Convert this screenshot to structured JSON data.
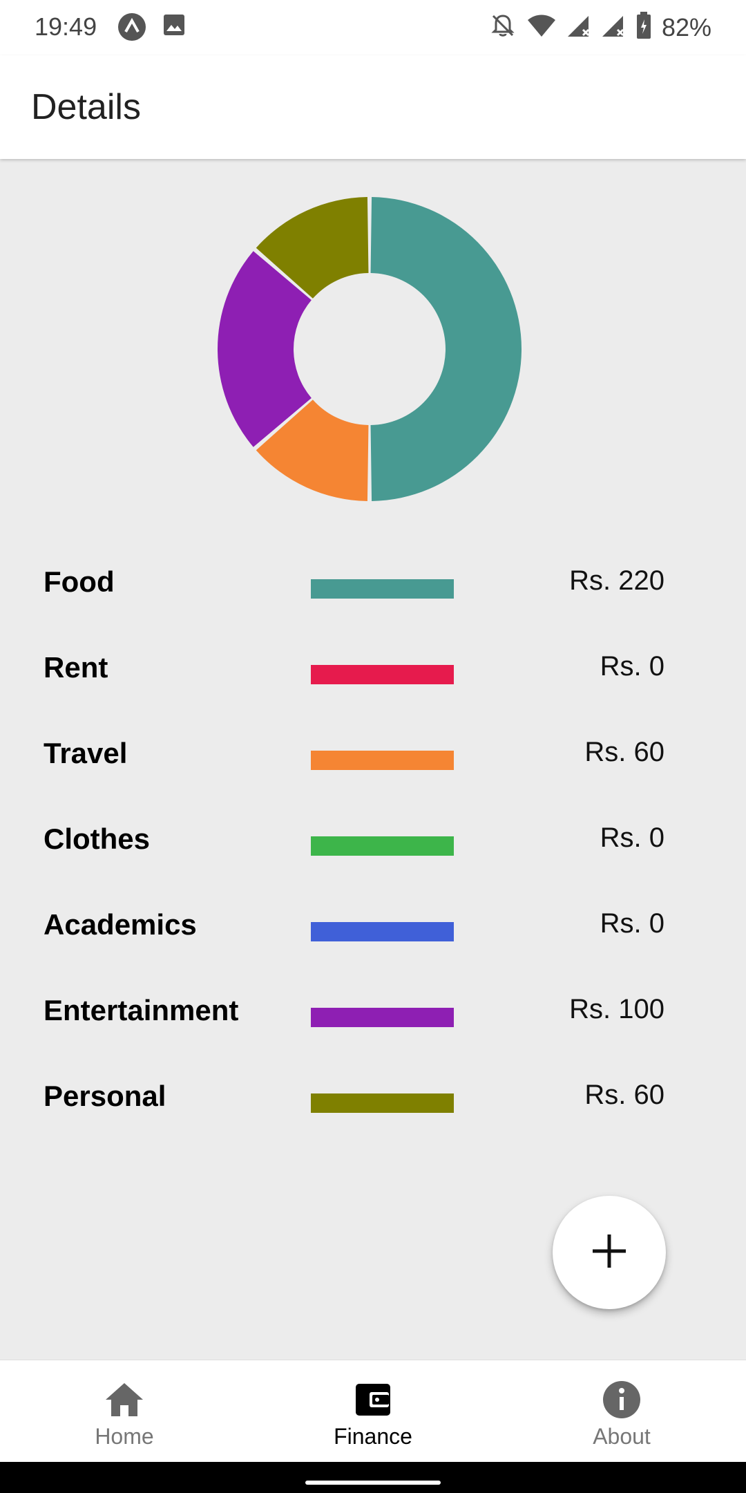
{
  "status_bar": {
    "time": "19:49",
    "battery": "82%",
    "icons": [
      "app-a-icon",
      "image-icon",
      "bell-off-icon",
      "wifi-icon",
      "signal-icon",
      "signal-icon",
      "battery-icon"
    ]
  },
  "app_bar": {
    "title": "Details"
  },
  "colors": {
    "food": "#489a92",
    "rent": "#e61b4d",
    "travel": "#f58533",
    "clothes": "#3db54a",
    "academics": "#4060d8",
    "entertainment": "#8e1fb3",
    "personal": "#7f8000"
  },
  "chart_data": {
    "type": "pie",
    "categories": [
      "Food",
      "Rent",
      "Travel",
      "Clothes",
      "Academics",
      "Entertainment",
      "Personal"
    ],
    "values": [
      220,
      0,
      60,
      0,
      0,
      100,
      60
    ],
    "colors": [
      "#489a92",
      "#e61b4d",
      "#f58533",
      "#3db54a",
      "#4060d8",
      "#8e1fb3",
      "#7f8000"
    ],
    "donut": true
  },
  "legend": [
    {
      "label": "Food",
      "amount": "Rs. 220",
      "color": "#489a92"
    },
    {
      "label": "Rent",
      "amount": "Rs. 0",
      "color": "#e61b4d"
    },
    {
      "label": "Travel",
      "amount": "Rs. 60",
      "color": "#f58533"
    },
    {
      "label": "Clothes",
      "amount": "Rs. 0",
      "color": "#3db54a"
    },
    {
      "label": "Academics",
      "amount": "Rs. 0",
      "color": "#4060d8"
    },
    {
      "label": "Entertainment",
      "amount": "Rs. 100",
      "color": "#8e1fb3"
    },
    {
      "label": "Personal",
      "amount": "Rs. 60",
      "color": "#7f8000"
    }
  ],
  "fab": {
    "icon": "plus-icon"
  },
  "bottom_nav": [
    {
      "label": "Home",
      "icon": "home-icon",
      "active": false
    },
    {
      "label": "Finance",
      "icon": "wallet-icon",
      "active": true
    },
    {
      "label": "About",
      "icon": "info-icon",
      "active": false
    }
  ]
}
